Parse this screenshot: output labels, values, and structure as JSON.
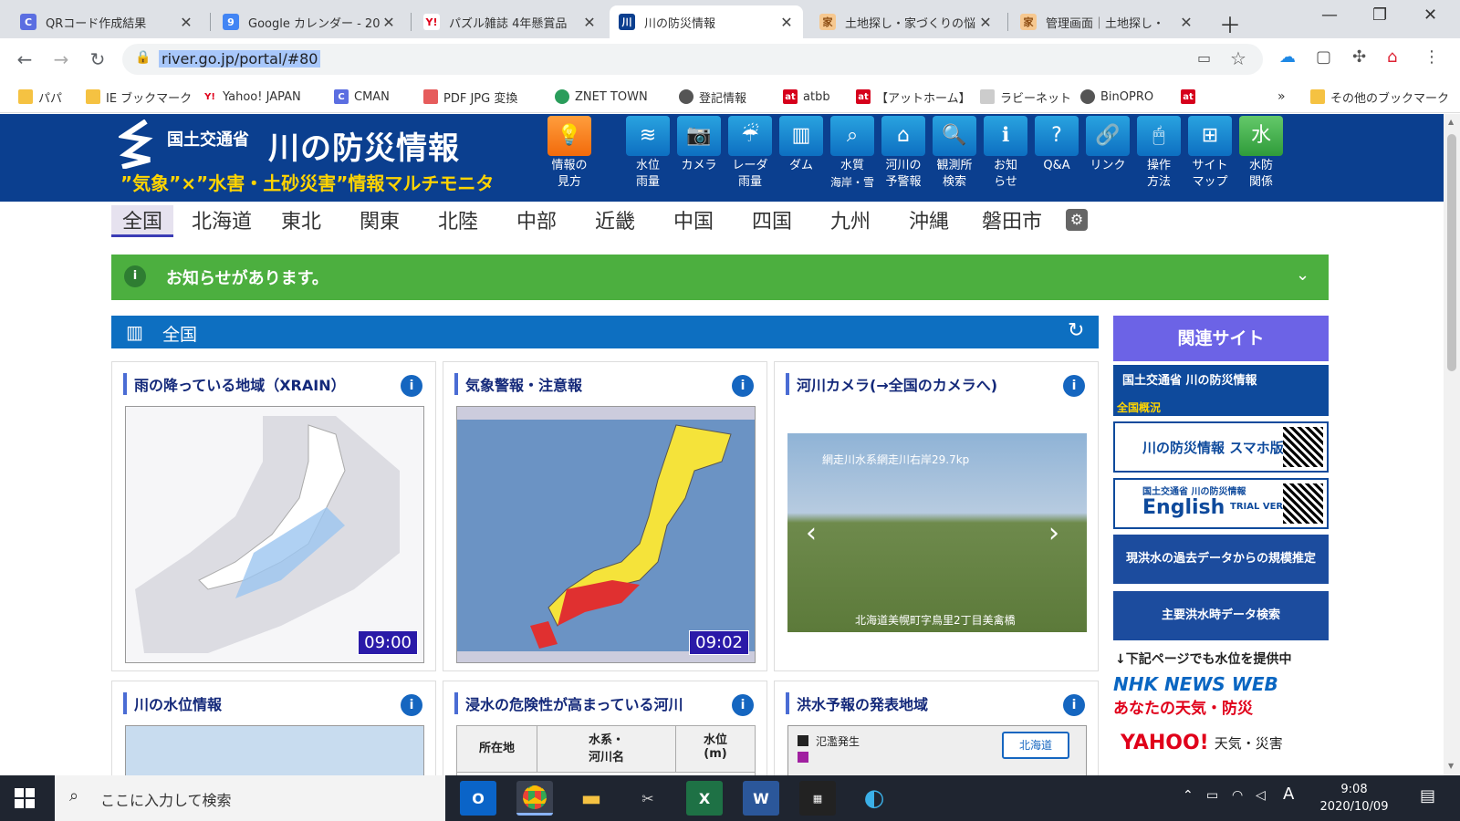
{
  "browser": {
    "tabs": [
      {
        "title": "QRコード作成結果",
        "favicon": "C"
      },
      {
        "title": "Google カレンダー - 20",
        "favicon": "9"
      },
      {
        "title": "パズル雑誌 4年懸賞品",
        "favicon": "Y!"
      },
      {
        "title": "川の防災情報",
        "favicon": "川"
      },
      {
        "title": "土地探し・家づくりの悩",
        "favicon": "家"
      },
      {
        "title": "管理画面｜土地探し・",
        "favicon": "家"
      }
    ],
    "url": "river.go.jp/portal/#80",
    "bookmarks": [
      "パパ",
      "IE ブックマーク",
      "Yahoo! JAPAN",
      "CMAN",
      "PDF JPG 変換",
      "ZNET TOWN",
      "登記情報",
      "atbb",
      "【アットホーム】",
      "ラビーネット",
      "BinOPRO",
      "»",
      "その他のブックマーク"
    ]
  },
  "site": {
    "ministry": "国土交通省",
    "title": "川の防災情報",
    "tagline": "”気象”×”水害・土砂災害”情報マルチモニタ",
    "nav": [
      {
        "label1": "情報の",
        "label2": "見方",
        "icon": "lightbulb-icon"
      },
      {
        "label1": "水位",
        "label2": "雨量",
        "icon": "water-level-icon"
      },
      {
        "label1": "カメラ",
        "label2": "",
        "icon": "camera-icon"
      },
      {
        "label1": "レーダ",
        "label2": "雨量",
        "icon": "radar-rain-icon"
      },
      {
        "label1": "ダム",
        "label2": "",
        "icon": "dam-icon"
      },
      {
        "label1": "水質",
        "label2": "海岸・雪",
        "icon": "water-quality-icon"
      },
      {
        "label1": "河川の",
        "label2": "予警報",
        "icon": "house-alert-icon"
      },
      {
        "label1": "観測所",
        "label2": "検索",
        "icon": "search-icon"
      },
      {
        "label1": "お知",
        "label2": "らせ",
        "icon": "info-icon"
      },
      {
        "label1": "Q&A",
        "label2": "",
        "icon": "question-icon"
      },
      {
        "label1": "リンク",
        "label2": "",
        "icon": "link-icon"
      },
      {
        "label1": "操作",
        "label2": "方法",
        "icon": "mouse-icon"
      },
      {
        "label1": "サイト",
        "label2": "マップ",
        "icon": "sitemap-icon"
      },
      {
        "label1": "水防",
        "label2": "関係",
        "icon": "suibo-icon"
      }
    ],
    "regions": [
      "全国",
      "北海道",
      "東北",
      "関東",
      "北陸",
      "中部",
      "近畿",
      "中国",
      "四国",
      "九州",
      "沖縄",
      "磐田市"
    ],
    "notice": "お知らせがあります。",
    "section": "全国",
    "cards": {
      "xrain": {
        "title": "雨の降っている地域（XRAIN）",
        "time": "09:00"
      },
      "warning": {
        "title": "気象警報・注意報",
        "time": "09:02"
      },
      "camera": {
        "title": "河川カメラ(→全国のカメラへ)",
        "caption_top": "網走川水系網走川右岸29.7kp",
        "caption_bottom": "北海道美幌町字鳥里2丁目美禽橋"
      },
      "water": {
        "title": "川の水位情報"
      },
      "flood": {
        "title": "浸水の危険性が高まっている河川",
        "col1": "所在地",
        "col2a": "水系・",
        "col2b": "河川名",
        "col3a": "水位",
        "col3b": "(m)"
      },
      "forecast": {
        "title": "洪水予報の発表地域",
        "legend1": "氾濫発生",
        "region_btn": "北海道"
      }
    },
    "sidebar": {
      "heading": "関連サイト",
      "banner1_top": "国土交通省 川の防災情報",
      "banner1_bottom": "全国概況",
      "banner2": "川の防災情報 スマホ版",
      "banner3_small": "国土交通省 川の防災情報",
      "banner3_big": "English",
      "banner3_trial": "TRIAL VERSION",
      "btn1": "現洪水の過去データからの規模推定",
      "btn2": "主要洪水時データ検索",
      "note": "↓下記ページでも水位を提供中",
      "nhk1": "NHK NEWS WEB",
      "nhk2": "あなたの天気・防災",
      "yahoo1": "YAHOO!",
      "yahoo2": "天気・災害"
    }
  },
  "taskbar": {
    "search_placeholder": "ここに入力して検索",
    "time": "9:08",
    "date": "2020/10/09",
    "ime": "A"
  }
}
